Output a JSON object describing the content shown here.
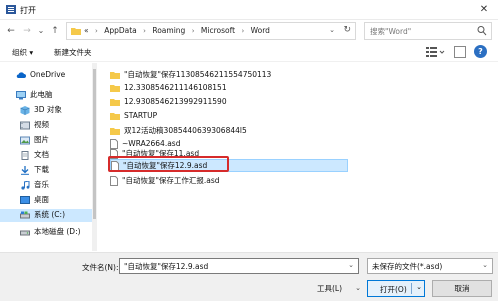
{
  "window": {
    "title": "打开",
    "close_glyph": "✕"
  },
  "nav": {
    "back": "←",
    "forward": "→",
    "recent": "⌄",
    "up": "↑"
  },
  "address": {
    "overflow": "«",
    "crumbs": [
      "AppData",
      "Roaming",
      "Microsoft",
      "Word"
    ],
    "separator": "›",
    "dropdown": "⌄",
    "refresh": "↻"
  },
  "search": {
    "placeholder": "搜索\"Word\""
  },
  "toolbar": {
    "organize_label": "组织 ▾",
    "new_folder_label": "新建文件夹",
    "help": "?"
  },
  "sidebar": {
    "items": [
      {
        "label": "OneDrive",
        "icon": "cloud-icon"
      },
      {
        "label": "此电脑",
        "icon": "computer-icon"
      },
      {
        "label": "3D 对象",
        "icon": "cube-icon"
      },
      {
        "label": "视频",
        "icon": "video-icon"
      },
      {
        "label": "图片",
        "icon": "picture-icon"
      },
      {
        "label": "文档",
        "icon": "document-icon"
      },
      {
        "label": "下载",
        "icon": "download-icon"
      },
      {
        "label": "音乐",
        "icon": "music-icon"
      },
      {
        "label": "桌面",
        "icon": "desktop-icon"
      },
      {
        "label": "系统 (C:)",
        "icon": "drive-icon"
      },
      {
        "label": "本地磁盘 (D:)",
        "icon": "drive-icon"
      }
    ]
  },
  "files": [
    {
      "name": "\"自动恢复\"保存11308546211554750113",
      "type": "folder"
    },
    {
      "name": "12.3308546211146108151",
      "type": "folder"
    },
    {
      "name": "12.9308546213992911590",
      "type": "folder"
    },
    {
      "name": "STARTUP",
      "type": "folder"
    },
    {
      "name": "双12活动稿3085440639306844l5",
      "type": "folder"
    },
    {
      "name": "~WRA2664.asd",
      "type": "file"
    },
    {
      "name": "\"自动恢复\"保存11.asd",
      "type": "file"
    },
    {
      "name": "\"自动恢复\"保存12.9.asd",
      "type": "file"
    },
    {
      "name": "\"自动恢复\"保存工作汇报.asd",
      "type": "file"
    }
  ],
  "footer": {
    "filename_label": "文件名(N):",
    "filename_value": "\"自动恢复\"保存12.9.asd",
    "filetype_value": "未保存的文件(*.asd)",
    "tools_label": "工具(L)",
    "open_label": "打开(O)",
    "cancel_label": "取消",
    "dropdown": "⌄"
  },
  "colors": {
    "selection": "#cce8ff",
    "highlight": "#d62b2b",
    "accent": "#0078d7",
    "folder": "#f5c94a"
  }
}
